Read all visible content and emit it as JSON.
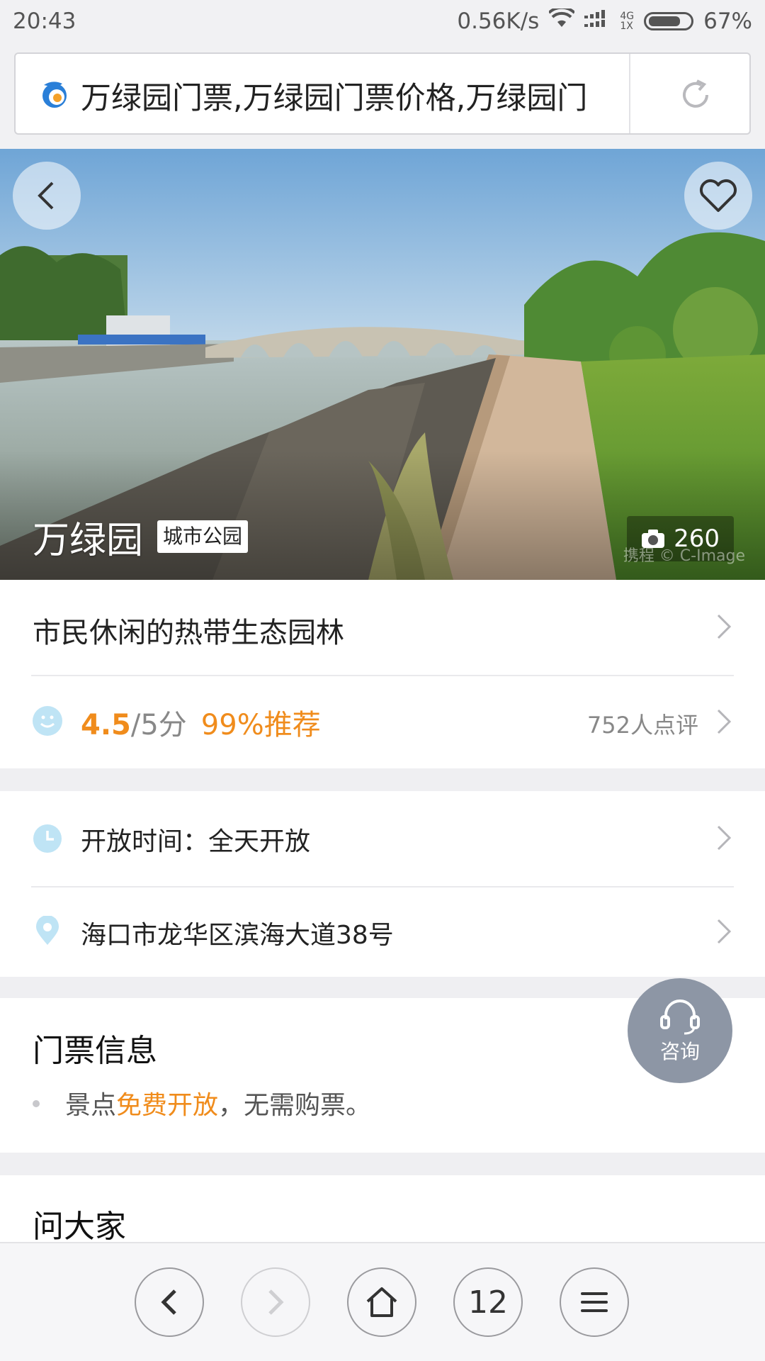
{
  "status_bar": {
    "time": "20:43",
    "net_speed": "0.56K/s",
    "sig_top": "4G",
    "sig_bottom": "1X",
    "battery": "67%"
  },
  "url_bar": {
    "text": "万绿园门票,万绿园门票价格,万绿园门"
  },
  "hero": {
    "title": "万绿园",
    "tag": "城市公园",
    "photo_count": "260",
    "watermark": "携程 © C-Image"
  },
  "summary": {
    "tagline": "市民休闲的热带生态园林",
    "score": "4.5",
    "score_total": "/5分",
    "recommend": "99%推荐",
    "reviews": "752人点评"
  },
  "info": {
    "hours": "开放时间：全天开放",
    "address": "海口市龙华区滨海大道38号"
  },
  "tickets": {
    "title": "门票信息",
    "line_prefix": "景点",
    "line_highlight": "免费开放",
    "line_suffix": "，无需购票。"
  },
  "consult_label": "咨询",
  "ask_title": "问大家",
  "bottom_nav": {
    "tabs_count": "12"
  },
  "colors": {
    "accent_orange": "#f08c1c",
    "consult_bg": "#8d96a5"
  }
}
